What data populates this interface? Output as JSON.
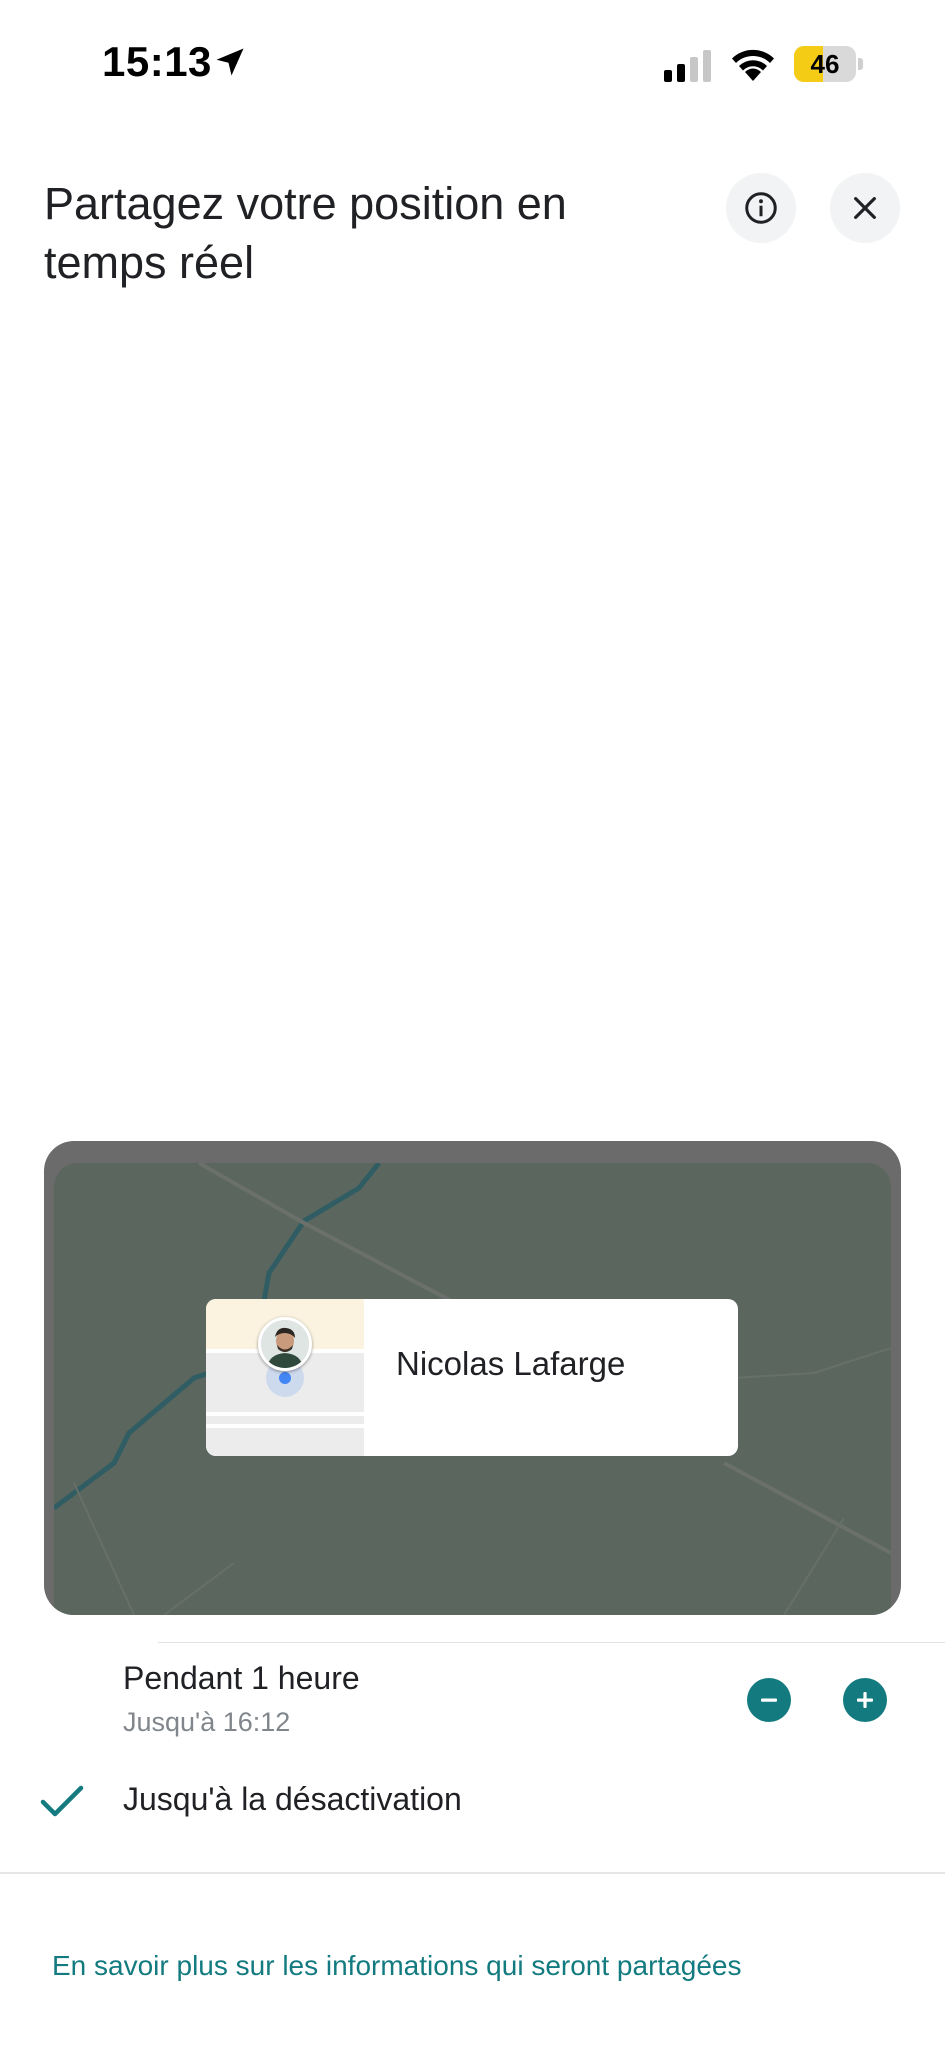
{
  "status_bar": {
    "time": "15:13",
    "battery_level": "46",
    "battery_color": "#f5cc15"
  },
  "header": {
    "title": "Partagez votre position en temps réel",
    "info_icon": "info-icon",
    "close_icon": "close-icon"
  },
  "preview": {
    "contact_name": "Nicolas Lafarge"
  },
  "duration_options": [
    {
      "label": "Pendant 1 heure",
      "sublabel": "Jusqu'à 16:12",
      "selected": false
    },
    {
      "label": "Jusqu'à la désactivation",
      "selected": true
    }
  ],
  "learn_more_link": "En savoir plus sur les informations qui seront partagées",
  "colors": {
    "accent": "#137b80",
    "map_background": "#5b665e"
  }
}
